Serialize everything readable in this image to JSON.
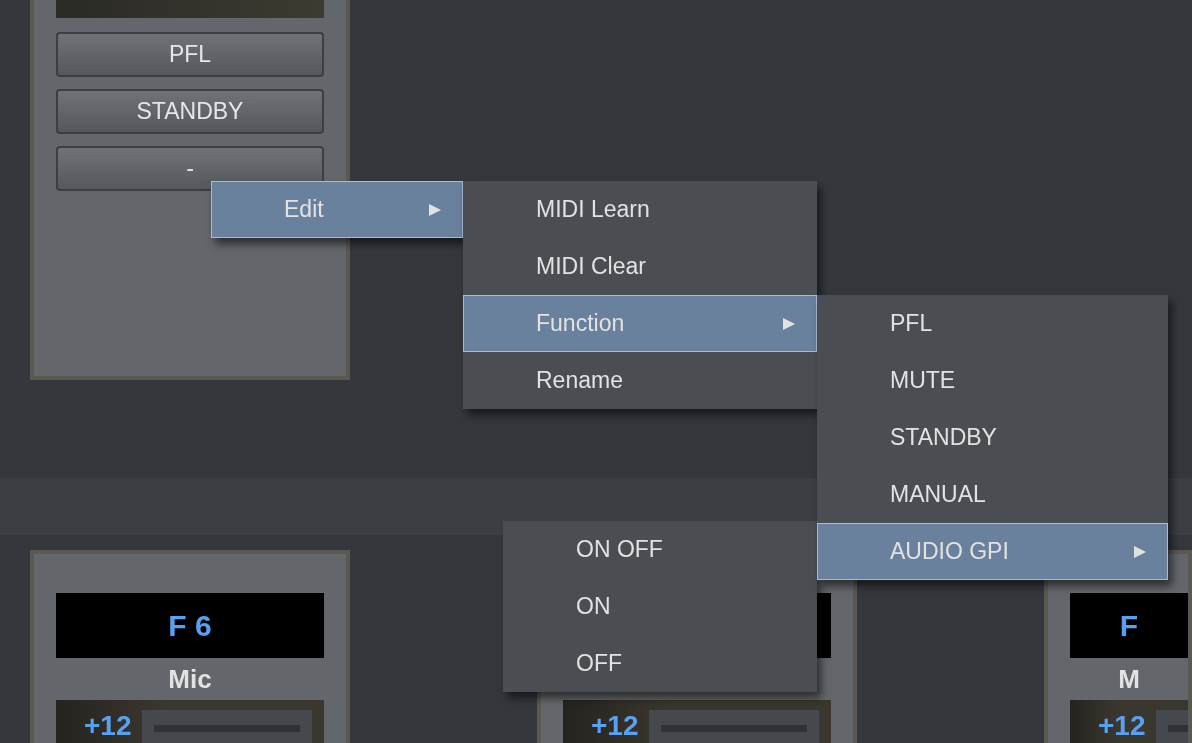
{
  "top_strip": {
    "buttons": [
      "PFL",
      "STANDBY",
      "-"
    ]
  },
  "bottom_strips": [
    {
      "display": "F 6",
      "name": "Mic",
      "gain": "+12",
      "level": 1
    },
    {
      "gain": "+12",
      "level": 1
    },
    {
      "display": "F",
      "name": "M",
      "gain": "+12",
      "level": 1
    }
  ],
  "menus": [
    {
      "items": [
        {
          "label": "Edit",
          "selected": true,
          "has_submenu": true
        }
      ]
    },
    {
      "items": [
        {
          "label": "MIDI Learn",
          "selected": false,
          "has_submenu": false
        },
        {
          "label": "MIDI Clear",
          "selected": false,
          "has_submenu": false
        },
        {
          "label": "Function",
          "selected": true,
          "has_submenu": true
        },
        {
          "label": "Rename",
          "selected": false,
          "has_submenu": false
        }
      ]
    },
    {
      "items": [
        {
          "label": "PFL",
          "selected": false,
          "has_submenu": false
        },
        {
          "label": "MUTE",
          "selected": false,
          "has_submenu": false
        },
        {
          "label": "STANDBY",
          "selected": false,
          "has_submenu": false
        },
        {
          "label": "MANUAL",
          "selected": false,
          "has_submenu": false
        },
        {
          "label": "AUDIO GPI",
          "selected": true,
          "has_submenu": true
        }
      ]
    },
    {
      "items": [
        {
          "label": "ON OFF",
          "selected": false,
          "has_submenu": false
        },
        {
          "label": "ON",
          "selected": false,
          "has_submenu": false
        },
        {
          "label": "OFF",
          "selected": false,
          "has_submenu": false
        }
      ]
    }
  ]
}
